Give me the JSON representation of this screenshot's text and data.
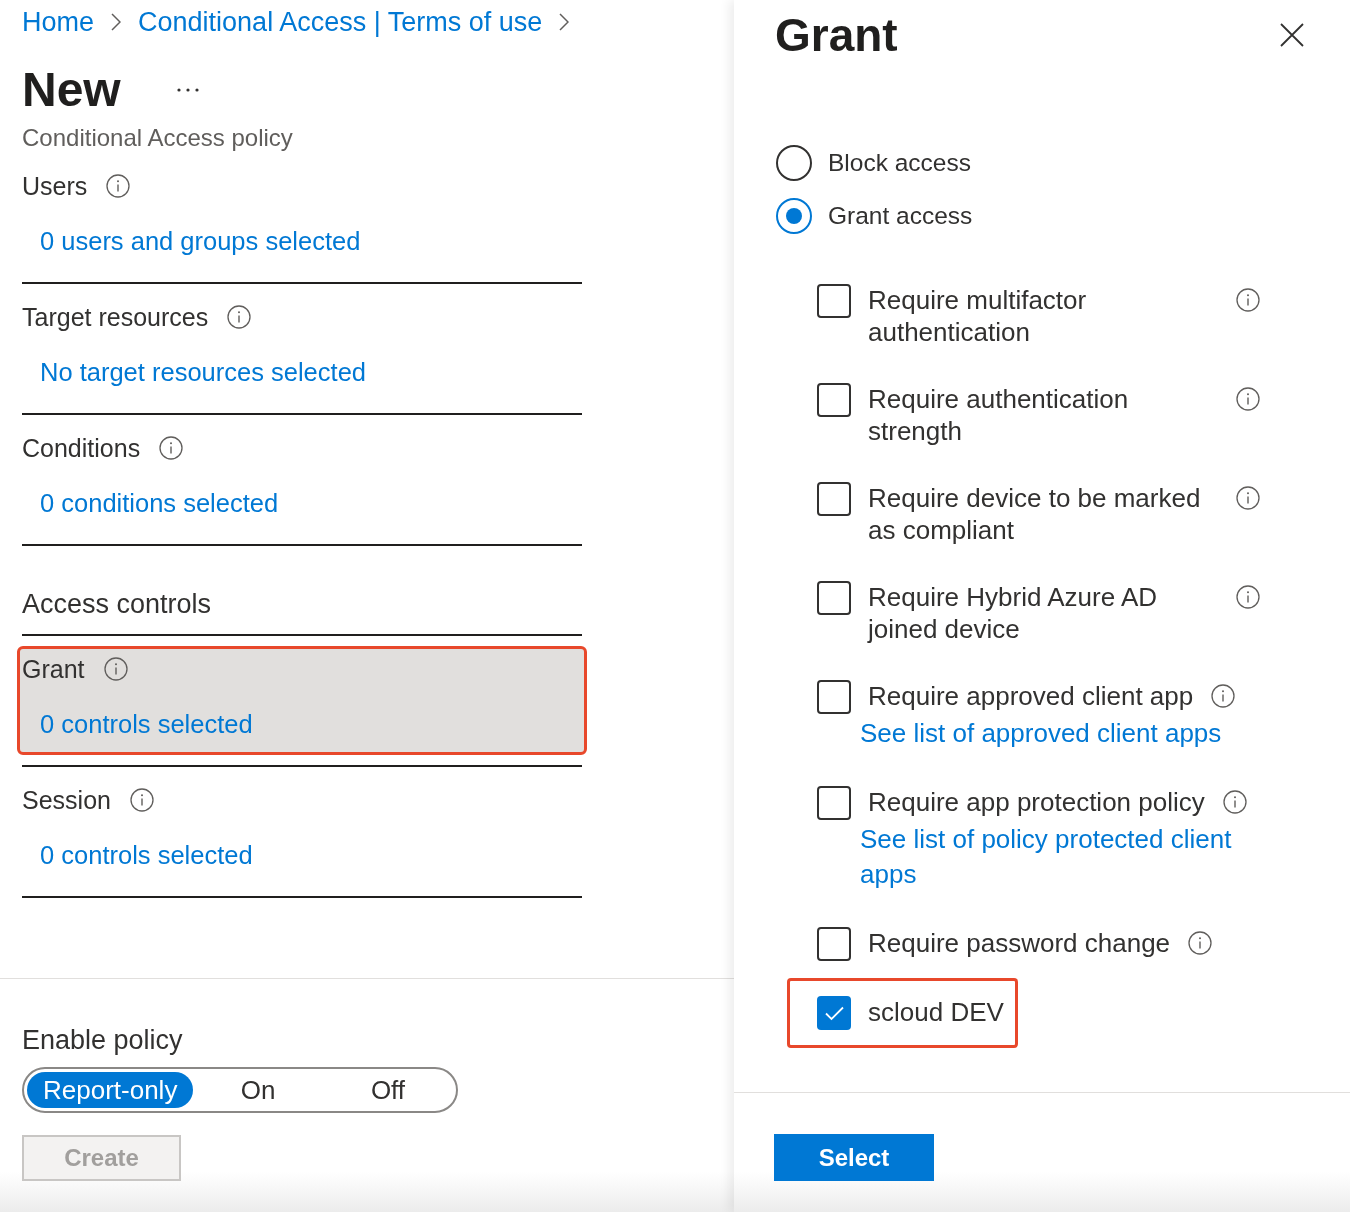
{
  "breadcrumb": [
    {
      "label": "Home"
    },
    {
      "label": "Conditional Access | Terms of use"
    }
  ],
  "page": {
    "title": "New",
    "subtitle": "Conditional Access policy"
  },
  "sections": [
    {
      "kind": "item",
      "label": "Users",
      "info": true,
      "value": "0 users and groups selected",
      "highlighted": false
    },
    {
      "kind": "item",
      "label": "Target resources",
      "info": true,
      "value": "No target resources selected",
      "highlighted": false
    },
    {
      "kind": "item",
      "label": "Conditions",
      "info": true,
      "value": "0 conditions selected",
      "highlighted": false
    },
    {
      "kind": "heading",
      "label": "Access controls"
    },
    {
      "kind": "item",
      "label": "Grant",
      "info": true,
      "value": "0 controls selected",
      "highlighted": true
    },
    {
      "kind": "item",
      "label": "Session",
      "info": true,
      "value": "0 controls selected",
      "highlighted": false
    }
  ],
  "enable_policy": {
    "label": "Enable policy",
    "options": [
      {
        "label": "Report-only",
        "selected": true
      },
      {
        "label": "On",
        "selected": false
      },
      {
        "label": "Off",
        "selected": false
      }
    ]
  },
  "create_button": {
    "label": "Create",
    "disabled": true
  },
  "grant_panel": {
    "title": "Grant",
    "access_options": [
      {
        "label": "Block access",
        "selected": false
      },
      {
        "label": "Grant access",
        "selected": true
      }
    ],
    "controls": [
      {
        "label": "Require multifactor authentication",
        "info": true,
        "checked": false,
        "highlighted": false
      },
      {
        "label": "Require authentication strength",
        "info": true,
        "checked": false,
        "highlighted": false
      },
      {
        "label": "Require device to be marked as compliant",
        "info": true,
        "checked": false,
        "highlighted": false
      },
      {
        "label": "Require Hybrid Azure AD joined device",
        "info": true,
        "checked": false,
        "highlighted": false
      },
      {
        "label": "Require approved client app",
        "info": true,
        "checked": false,
        "highlighted": false,
        "link": "See list of approved client apps"
      },
      {
        "label": "Require app protection policy",
        "info": true,
        "checked": false,
        "highlighted": false,
        "link": "See list of policy protected client apps"
      },
      {
        "label": "Require password change",
        "info": true,
        "checked": false,
        "highlighted": false
      },
      {
        "label": "scloud DEV",
        "info": false,
        "checked": true,
        "highlighted": true
      }
    ],
    "select_button": {
      "label": "Select"
    }
  }
}
